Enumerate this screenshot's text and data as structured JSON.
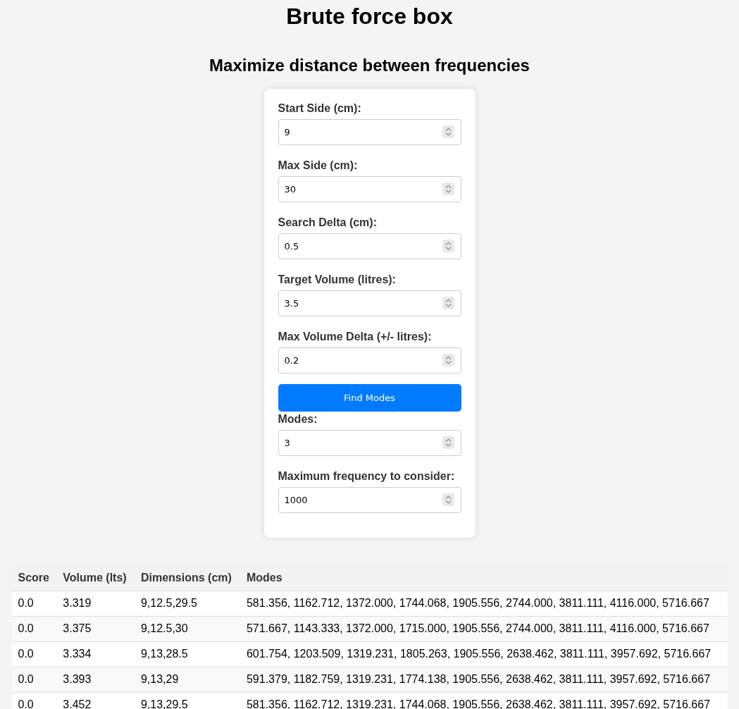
{
  "title": "Brute force box",
  "subtitle": "Maximize distance between frequencies",
  "form": [
    {
      "kind": "field",
      "label": "Start Side (cm):",
      "value": "9"
    },
    {
      "kind": "field",
      "label": "Max Side (cm):",
      "value": "30"
    },
    {
      "kind": "field",
      "label": "Search Delta (cm):",
      "value": "0.5"
    },
    {
      "kind": "field",
      "label": "Target Volume (litres):",
      "value": "3.5"
    },
    {
      "kind": "field",
      "label": "Max Volume Delta (+/- litres):",
      "value": "0.2"
    },
    {
      "kind": "button",
      "label": "Find Modes"
    },
    {
      "kind": "field",
      "label": "Modes:",
      "value": "3"
    },
    {
      "kind": "field",
      "label": "Maximum frequency to consider:",
      "value": "1000"
    }
  ],
  "table": {
    "columns": [
      "Score",
      "Volume (lts)",
      "Dimensions (cm)",
      "Modes"
    ],
    "rows": [
      [
        "0.0",
        "3.319",
        "9,12.5,29.5",
        "581.356, 1162.712, 1372.000, 1744.068, 1905.556, 2744.000, 3811.111, 4116.000, 5716.667"
      ],
      [
        "0.0",
        "3.375",
        "9,12.5,30",
        "571.667, 1143.333, 1372.000, 1715.000, 1905.556, 2744.000, 3811.111, 4116.000, 5716.667"
      ],
      [
        "0.0",
        "3.334",
        "9,13,28.5",
        "601.754, 1203.509, 1319.231, 1805.263, 1905.556, 2638.462, 3811.111, 3957.692, 5716.667"
      ],
      [
        "0.0",
        "3.393",
        "9,13,29",
        "591.379, 1182.759, 1319.231, 1774.138, 1905.556, 2638.462, 3811.111, 3957.692, 5716.667"
      ],
      [
        "0.0",
        "3.452",
        "9,13,29.5",
        "581.356, 1162.712, 1319.231, 1744.068, 1905.556, 2638.462, 3811.111, 3957.692, 5716.667"
      ]
    ]
  }
}
